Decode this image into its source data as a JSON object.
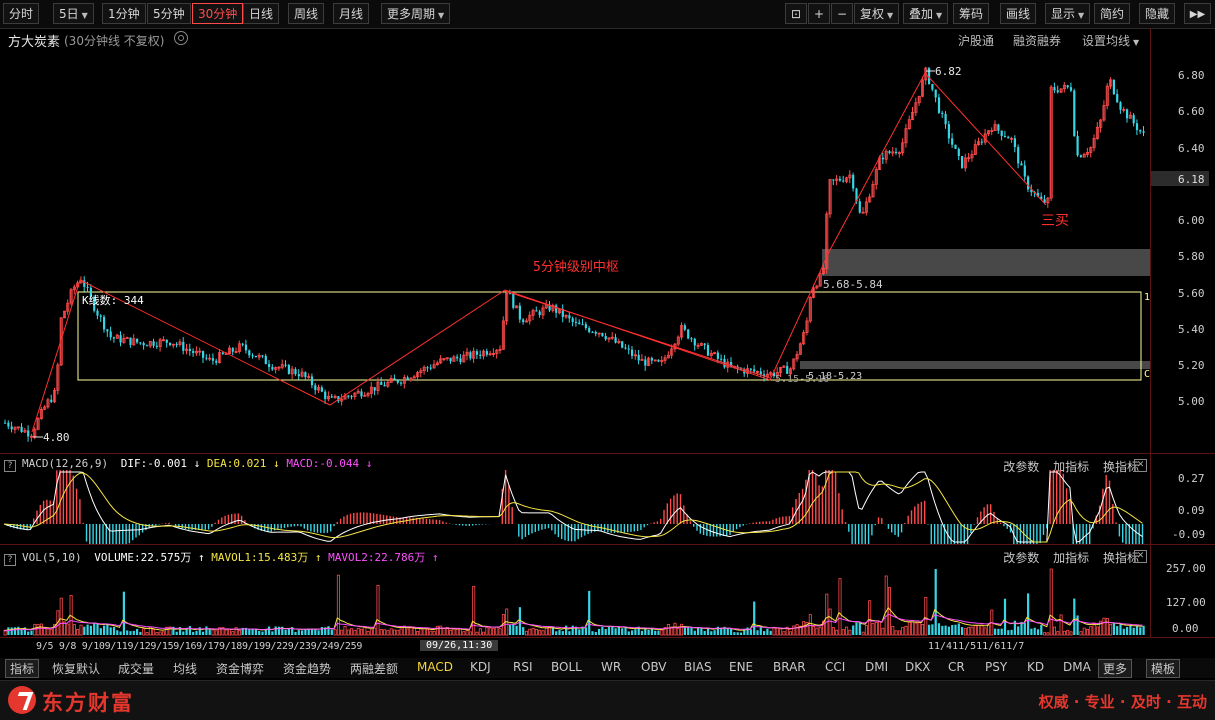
{
  "toolbar": {
    "periods": [
      "分时",
      "5日",
      "1分钟",
      "5分钟",
      "30分钟",
      "日线",
      "周线",
      "月线",
      "更多周期"
    ],
    "active_period": "30分钟",
    "right_tools": [
      "复权",
      "叠加",
      "筹码",
      "画线",
      "显示",
      "简约",
      "隐藏"
    ]
  },
  "header": {
    "stock_name": "方大炭素",
    "period_label": "(30分钟线 不复权)",
    "links": [
      "沪股通",
      "融资融券",
      "设置均线"
    ]
  },
  "price_axis": {
    "ticks": [
      "6.80",
      "6.60",
      "6.40",
      "6.20",
      "6.00",
      "5.80",
      "5.60",
      "5.40",
      "5.20",
      "5.00"
    ],
    "current": "6.18"
  },
  "annotations": {
    "high_label": "6.82",
    "low_label": "4.80",
    "kline_count": "K线数: 344",
    "zone_title": "5分钟级别中枢",
    "zone_upper": "5.68-5.84",
    "zone_lower": "5.15-5.16",
    "zone_lower2": "5.18-5.23",
    "buy_label": "三买",
    "box_right_top": "1",
    "box_right_bottom": "C"
  },
  "macd": {
    "name": "MACD(12,26,9)",
    "dif": "DIF:-0.001",
    "dea": "DEA:0.021",
    "macd": "MACD:-0.044",
    "axis": [
      "0.27",
      "0.09",
      "-0.09"
    ],
    "tools": [
      "改参数",
      "加指标",
      "换指标"
    ]
  },
  "vol": {
    "name": "VOL(5,10)",
    "volume": "VOLUME:22.575万",
    "mavol1": "MAVOL1:15.483万",
    "mavol2": "MAVOL2:22.786万",
    "axis": [
      "257.00",
      "127.00",
      "0.00"
    ],
    "tools": [
      "改参数",
      "加指标",
      "换指标"
    ]
  },
  "time_axis": {
    "left_labels": "9/5 9/8 9/109/119/129/159/169/179/189/199/229/239/249/259",
    "cursor": "09/26,11:30",
    "right_labels": "11/411/511/611/7"
  },
  "tabs": [
    "指标",
    "恢复默认",
    "成交量",
    "均线",
    "资金博弈",
    "资金趋势",
    "两融差额",
    "MACD",
    "KDJ",
    "RSI",
    "BOLL",
    "WR",
    "OBV",
    "BIAS",
    "ENE",
    "BRAR",
    "CCI",
    "DMI",
    "DKX",
    "CR",
    "PSY",
    "KD",
    "DMA",
    "更多",
    "模板"
  ],
  "footer": {
    "brand": "东方财富",
    "slogan": "权威 · 专业 · 及时 · 互动"
  },
  "colors": {
    "up": "#ff4b4b",
    "down": "#36d6e7",
    "zone_box": "#ffff99",
    "annotation_red": "#ff3030"
  }
}
